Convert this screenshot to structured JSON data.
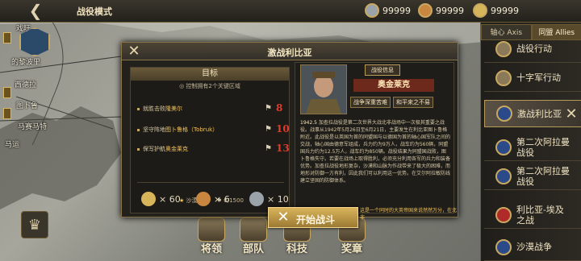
{
  "header": {
    "title": "战役模式",
    "resources": [
      {
        "icon": "medal-icon",
        "value": "99999",
        "color": "#9aa3aa"
      },
      {
        "icon": "bronze-medal-icon",
        "value": "99999",
        "color": "#c8863f"
      },
      {
        "icon": "star-medal-icon",
        "value": "99999",
        "color": "#d6b45a"
      }
    ]
  },
  "map": {
    "cities": [
      "戏旺",
      "的黎波里",
      "西德拉",
      "图卜鲁",
      "马赛马特",
      "马运"
    ]
  },
  "sidebar": {
    "tabs": [
      {
        "label": "轴心 Axis",
        "active": false
      },
      {
        "label": "同盟 Allies",
        "active": true
      }
    ],
    "campaigns": [
      {
        "label": "战役行动",
        "icon": "flag-icon",
        "color": "#8a7a5a"
      },
      {
        "label": "十字军行动",
        "icon": "flag-icon",
        "color": "#8a7a5a"
      },
      {
        "label": "激战利比亚",
        "icon": "uk-flag-icon",
        "color": "#2a4a8a",
        "selected": true
      },
      {
        "label": "第二次阿拉曼\n战役",
        "icon": "uk-flag-icon",
        "color": "#2a4a8a"
      },
      {
        "label": "第二次阿拉曼\n战役",
        "icon": "uk-flag-icon",
        "color": "#2a4a8a"
      },
      {
        "label": "利比亚-埃及\n之战",
        "icon": "italy-flag-icon",
        "color": "#b02a2a"
      },
      {
        "label": "沙漠战争",
        "icon": "uk-flag-icon",
        "color": "#2a4a8a"
      }
    ]
  },
  "bottom": {
    "tools": [
      {
        "label": "将领",
        "icon": "general-icon"
      },
      {
        "label": "部队",
        "icon": "unit-icon"
      },
      {
        "label": "科技",
        "icon": "tech-icon"
      },
      {
        "label": "奖章",
        "icon": "medal-icon"
      }
    ]
  },
  "dialog": {
    "title": "激战利比亚",
    "objectives": {
      "title": "目标",
      "subtitle": "控制拥有2个关键区域",
      "items": [
        {
          "prefix": "就胜击败",
          "highlight": "隆美尔",
          "suffix": "",
          "num": "8"
        },
        {
          "prefix": "坚守阵地",
          "highlight": "图卜鲁格（Tobruk）",
          "suffix": "",
          "num": "10"
        },
        {
          "prefix": "保写护航",
          "highlight": "奥金莱克",
          "suffix": "",
          "num": "13"
        }
      ],
      "progress_label": "沙漠战争",
      "progress_value": "0/1500"
    },
    "rewards": [
      {
        "icon": "star-medal-icon",
        "value": "× 60",
        "color": "#d6b45a"
      },
      {
        "icon": "bronze-medal-icon",
        "value": "× 6",
        "color": "#c8863f"
      },
      {
        "icon": "medal-icon",
        "value": "× 10",
        "color": "#9aa3aa"
      }
    ],
    "info": {
      "tag": "战役信息",
      "general_name": "奥金莱克",
      "traits": [
        "战争深重苦难",
        "和平来之不易"
      ],
      "lead": "1942.5",
      "body": "加查拉战役是第二次世界大战北非战场中一次极其重要之战役。战事从1942年5月26日至6月21日，主要发生在利比亚图卜鲁格附近。此战役是以英国为首的同盟国与以德国为首的轴心国军队之间的交战，轴心国由德意军组成，兵力约为9万人，战车约为560辆，同盟国兵力约为12.5万人，战车约为850辆。战役结果为同盟国战败，图卜鲁格失守。若要在战场上取得胜利，必须充分利用各军的兵力和装备优势。加查拉战役地形复杂，沙漠和山脉为作战带来了极大的困难，而地形对防御一方有利，因此我们可以利用这一优势。在艾尔阿拉敏防线建立坚固的防御体系。",
      "highlight": "这是一个同时的大英帝国来说然然万分，在北非"
    },
    "start_label": "开始战斗"
  }
}
